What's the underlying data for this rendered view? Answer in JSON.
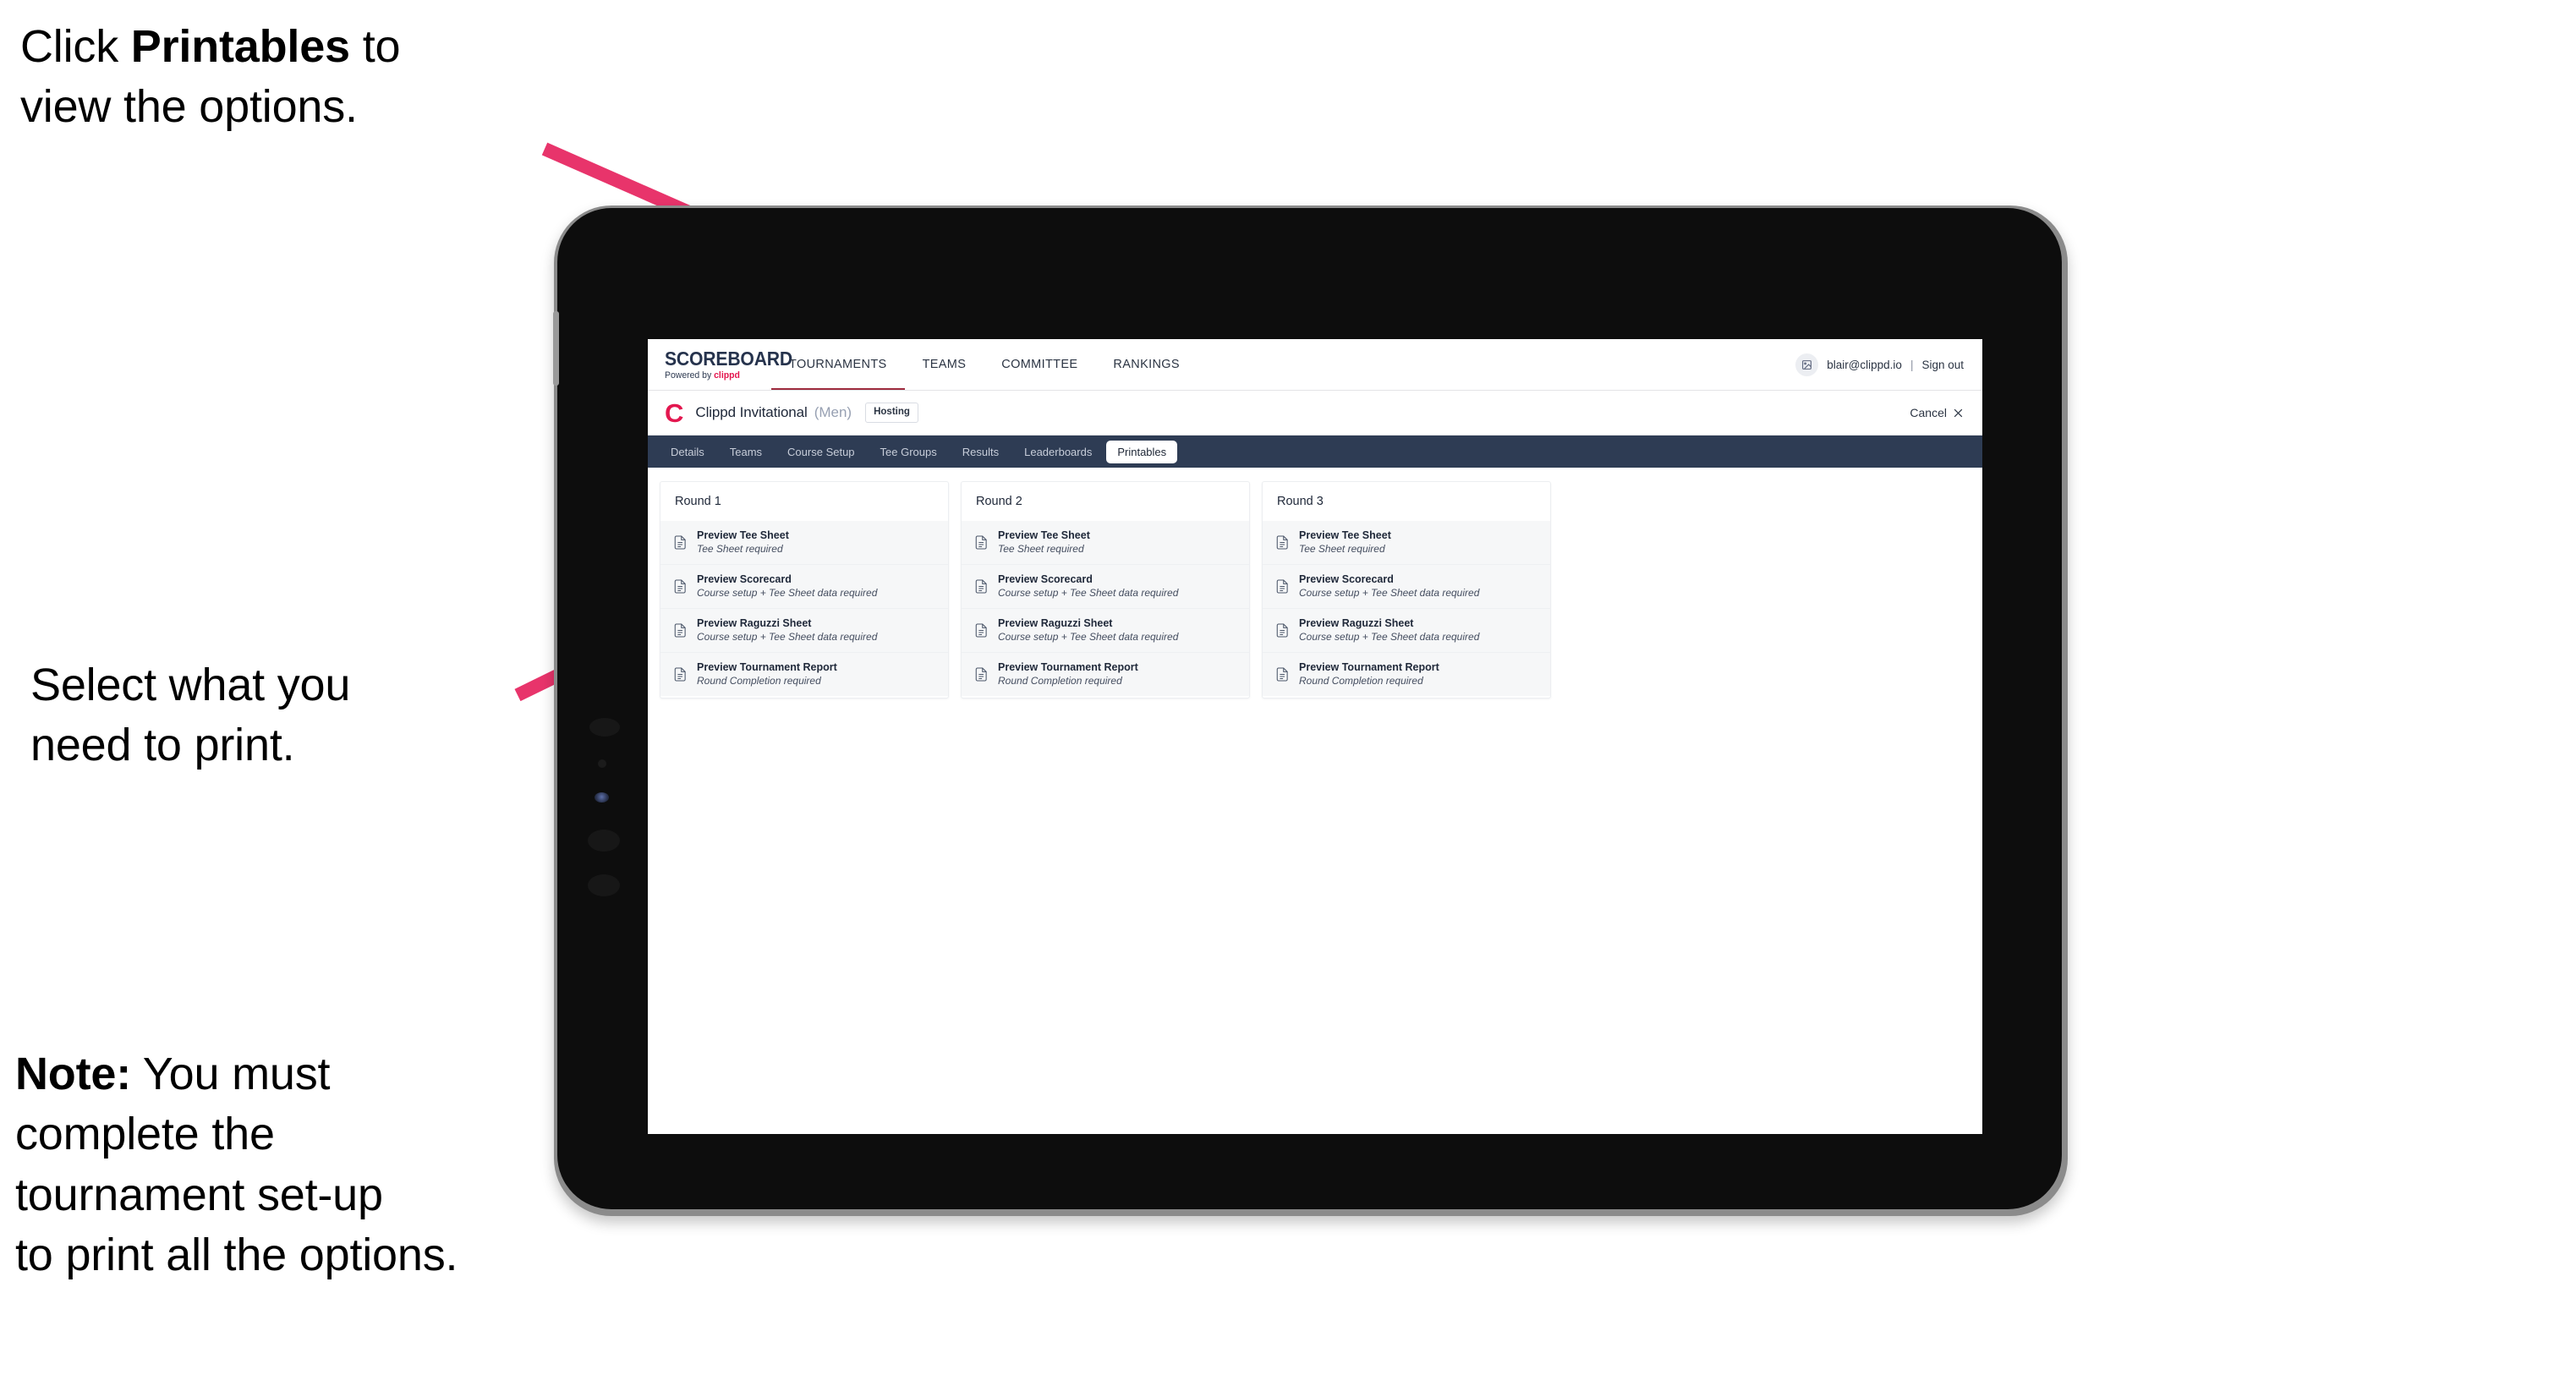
{
  "annotations": [
    {
      "id": "click",
      "lead": "Click ",
      "bold": "Printables",
      "tail": " to\nview the options."
    },
    {
      "id": "select",
      "lead": "Select what you\n need to print.",
      "bold": "",
      "tail": ""
    },
    {
      "id": "note",
      "lead": "",
      "bold": "Note:",
      "tail": " You must\ncomplete the\ntournament set-up\nto print all the options."
    }
  ],
  "colors": {
    "arrow_pink": "#e8346b",
    "brand_pink": "#e3174f",
    "navy": "#2e3c54",
    "active_underline": "#9e2b3e"
  },
  "app": {
    "brand": {
      "name": "SCOREBOARD",
      "powered_prefix": "Powered by ",
      "powered_brand": "clippd"
    },
    "topnav": [
      {
        "label": "TOURNAMENTS",
        "active": true
      },
      {
        "label": "TEAMS",
        "active": false
      },
      {
        "label": "COMMITTEE",
        "active": false
      },
      {
        "label": "RANKINGS",
        "active": false
      }
    ],
    "account": {
      "avatar_icon": "user-image-icon",
      "email": "blair@clippd.io",
      "separator": "|",
      "sign_out": "Sign out"
    },
    "tournament": {
      "logo_letter": "C",
      "name": "Clippd Invitational",
      "gender": "(Men)",
      "badge": "Hosting",
      "cancel": "Cancel",
      "cancel_icon": "close-icon"
    },
    "subtabs": [
      {
        "label": "Details",
        "active": false
      },
      {
        "label": "Teams",
        "active": false
      },
      {
        "label": "Course Setup",
        "active": false
      },
      {
        "label": "Tee Groups",
        "active": false
      },
      {
        "label": "Results",
        "active": false
      },
      {
        "label": "Leaderboards",
        "active": false
      },
      {
        "label": "Printables",
        "active": true
      }
    ],
    "rounds": [
      {
        "title": "Round 1",
        "items": [
          {
            "title": "Preview Tee Sheet",
            "sub": "Tee Sheet required"
          },
          {
            "title": "Preview Scorecard",
            "sub": "Course setup + Tee Sheet data required"
          },
          {
            "title": "Preview Raguzzi Sheet",
            "sub": "Course setup + Tee Sheet data required"
          },
          {
            "title": "Preview Tournament Report",
            "sub": "Round Completion required"
          }
        ]
      },
      {
        "title": "Round 2",
        "items": [
          {
            "title": "Preview Tee Sheet",
            "sub": "Tee Sheet required"
          },
          {
            "title": "Preview Scorecard",
            "sub": "Course setup + Tee Sheet data required"
          },
          {
            "title": "Preview Raguzzi Sheet",
            "sub": "Course setup + Tee Sheet data required"
          },
          {
            "title": "Preview Tournament Report",
            "sub": "Round Completion required"
          }
        ]
      },
      {
        "title": "Round 3",
        "items": [
          {
            "title": "Preview Tee Sheet",
            "sub": "Tee Sheet required"
          },
          {
            "title": "Preview Scorecard",
            "sub": "Course setup + Tee Sheet data required"
          },
          {
            "title": "Preview Raguzzi Sheet",
            "sub": "Course setup + Tee Sheet data required"
          },
          {
            "title": "Preview Tournament Report",
            "sub": "Round Completion required"
          }
        ]
      }
    ]
  }
}
